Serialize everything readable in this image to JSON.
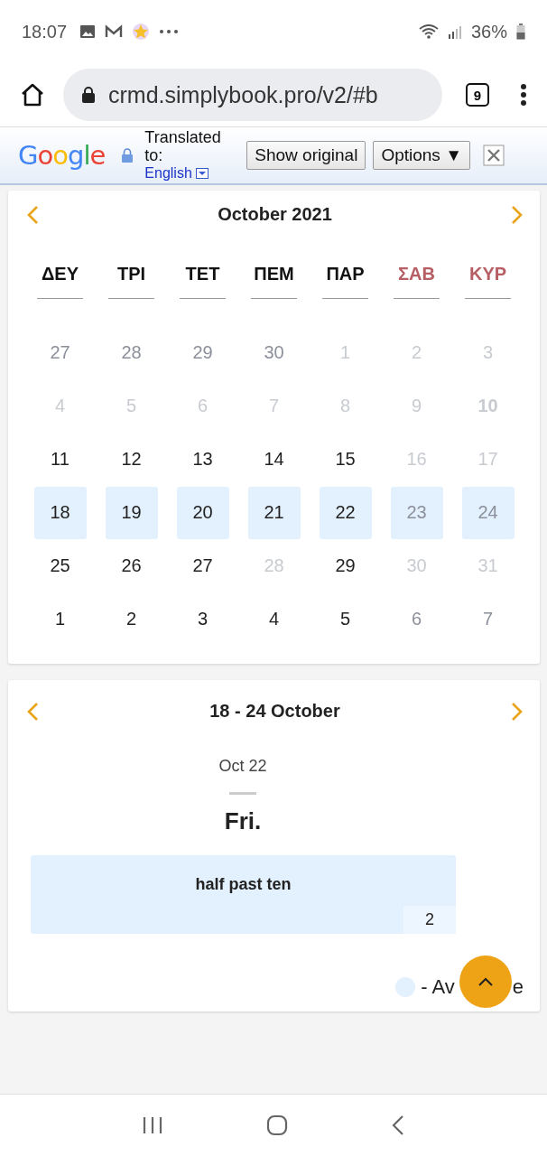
{
  "status_bar": {
    "time": "18:07",
    "battery": "36%"
  },
  "browser": {
    "url": "crmd.simplybook.pro/v2/#b",
    "tab_count": "9"
  },
  "translate_bar": {
    "logo": "Google",
    "label": "Translated to:",
    "language": "English",
    "show_original": "Show original",
    "options": "Options",
    "options_caret": "▼"
  },
  "month_calendar": {
    "title": "October 2021",
    "weekdays": [
      {
        "label": "ΔΕΥ",
        "weekend": false
      },
      {
        "label": "ΤΡΙ",
        "weekend": false
      },
      {
        "label": "ΤΕΤ",
        "weekend": false
      },
      {
        "label": "ΠΕΜ",
        "weekend": false
      },
      {
        "label": "ΠΑΡ",
        "weekend": false
      },
      {
        "label": "ΣΑΒ",
        "weekend": true
      },
      {
        "label": "ΚΥΡ",
        "weekend": true
      }
    ],
    "weeks": [
      [
        {
          "label": "27",
          "kind": "outside",
          "selected": false,
          "today": false
        },
        {
          "label": "28",
          "kind": "outside",
          "selected": false,
          "today": false
        },
        {
          "label": "29",
          "kind": "outside",
          "selected": false,
          "today": false
        },
        {
          "label": "30",
          "kind": "outside",
          "selected": false,
          "today": false
        },
        {
          "label": "1",
          "kind": "unavailable",
          "selected": false,
          "today": false
        },
        {
          "label": "2",
          "kind": "unavailable",
          "selected": false,
          "today": false
        },
        {
          "label": "3",
          "kind": "unavailable",
          "selected": false,
          "today": false
        }
      ],
      [
        {
          "label": "4",
          "kind": "unavailable",
          "selected": false,
          "today": false
        },
        {
          "label": "5",
          "kind": "unavailable",
          "selected": false,
          "today": false
        },
        {
          "label": "6",
          "kind": "unavailable",
          "selected": false,
          "today": false
        },
        {
          "label": "7",
          "kind": "unavailable",
          "selected": false,
          "today": false
        },
        {
          "label": "8",
          "kind": "unavailable",
          "selected": false,
          "today": false
        },
        {
          "label": "9",
          "kind": "unavailable",
          "selected": false,
          "today": false
        },
        {
          "label": "10",
          "kind": "unavailable",
          "selected": false,
          "today": true
        }
      ],
      [
        {
          "label": "11",
          "kind": "available",
          "selected": false,
          "today": false
        },
        {
          "label": "12",
          "kind": "available",
          "selected": false,
          "today": false
        },
        {
          "label": "13",
          "kind": "available",
          "selected": false,
          "today": false
        },
        {
          "label": "14",
          "kind": "available",
          "selected": false,
          "today": false
        },
        {
          "label": "15",
          "kind": "available",
          "selected": false,
          "today": false
        },
        {
          "label": "16",
          "kind": "unavailable",
          "selected": false,
          "today": false
        },
        {
          "label": "17",
          "kind": "unavailable",
          "selected": false,
          "today": false
        }
      ],
      [
        {
          "label": "18",
          "kind": "available",
          "selected": true,
          "today": false
        },
        {
          "label": "19",
          "kind": "available",
          "selected": true,
          "today": false
        },
        {
          "label": "20",
          "kind": "available",
          "selected": true,
          "today": false
        },
        {
          "label": "21",
          "kind": "available",
          "selected": true,
          "today": false
        },
        {
          "label": "22",
          "kind": "available",
          "selected": true,
          "today": false
        },
        {
          "label": "23",
          "kind": "outside",
          "selected": true,
          "today": false
        },
        {
          "label": "24",
          "kind": "outside",
          "selected": true,
          "today": false
        }
      ],
      [
        {
          "label": "25",
          "kind": "available",
          "selected": false,
          "today": false
        },
        {
          "label": "26",
          "kind": "available",
          "selected": false,
          "today": false
        },
        {
          "label": "27",
          "kind": "available",
          "selected": false,
          "today": false
        },
        {
          "label": "28",
          "kind": "unavailable",
          "selected": false,
          "today": false
        },
        {
          "label": "29",
          "kind": "available",
          "selected": false,
          "today": false
        },
        {
          "label": "30",
          "kind": "unavailable",
          "selected": false,
          "today": false
        },
        {
          "label": "31",
          "kind": "unavailable",
          "selected": false,
          "today": false
        }
      ],
      [
        {
          "label": "1",
          "kind": "available",
          "selected": false,
          "today": false
        },
        {
          "label": "2",
          "kind": "available",
          "selected": false,
          "today": false
        },
        {
          "label": "3",
          "kind": "available",
          "selected": false,
          "today": false
        },
        {
          "label": "4",
          "kind": "available",
          "selected": false,
          "today": false
        },
        {
          "label": "5",
          "kind": "available",
          "selected": false,
          "today": false
        },
        {
          "label": "6",
          "kind": "outside",
          "selected": false,
          "today": false
        },
        {
          "label": "7",
          "kind": "outside",
          "selected": false,
          "today": false
        }
      ]
    ]
  },
  "week_view": {
    "title": "18 - 24 October",
    "date": "Oct 22",
    "weekday": "Fri.",
    "slots": [
      {
        "time": "half past ten",
        "count": "2"
      }
    ],
    "legend": {
      "text_before": "- Av",
      "text_after": "e"
    }
  }
}
